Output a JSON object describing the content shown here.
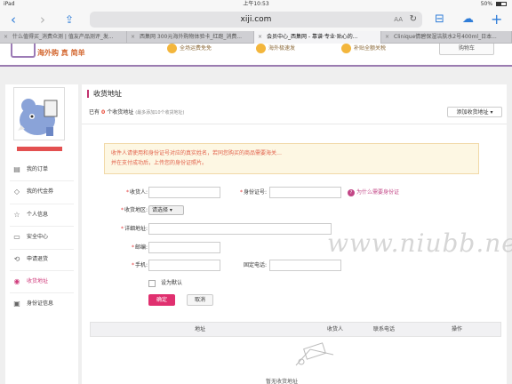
{
  "status_bar": {
    "device": "iPad",
    "time": "上午10:53",
    "battery": "50%"
  },
  "safari": {
    "url": "xiji.com",
    "font_btn": "AA",
    "back_icon": "chevron-left-icon",
    "forward_icon": "chevron-right-icon",
    "share_icon": "share-icon",
    "book_icon": "book-icon",
    "cloud_icon": "cloud-icon",
    "add_icon": "plus-icon"
  },
  "tabs": [
    {
      "label": "什么值得买_消费众测 | 值友产品测评_发..."
    },
    {
      "label": "西集网 300元海外购物体验卡_红跑_消费..."
    },
    {
      "label": "会员中心_西集网 - 靠谱·专业·贴心的..."
    },
    {
      "label": "Clinique倩碧保湿洁肤水2号400ml_日本..."
    }
  ],
  "site_header": {
    "slogan": "海外购 真 简单",
    "features": [
      "全场运费免免",
      "海外极速发",
      "补贴全额关税"
    ],
    "cart_label": "购物车"
  },
  "sidebar": {
    "items": [
      {
        "label": "我的订单",
        "icon": "document-icon"
      },
      {
        "label": "我的代金券",
        "icon": "tag-icon"
      },
      {
        "label": "个人信息",
        "icon": "star-icon"
      },
      {
        "label": "安全中心",
        "icon": "shield-icon"
      },
      {
        "label": "申请退货",
        "icon": "return-icon"
      },
      {
        "label": "收货地址",
        "icon": "location-pin-icon"
      },
      {
        "label": "身份证信息",
        "icon": "id-card-icon"
      }
    ]
  },
  "main": {
    "title": "收货地址",
    "count_prefix": "已有",
    "count": "0",
    "count_suffix": "个收货地址",
    "count_hint": "(最多添加10个收货地址)",
    "add_button": "添加收货地址 ▾",
    "notice_lines": [
      "收件人请使用和身份证号对应的真实姓名，若同您购买的商品需要海关…",
      "并在支付成功后，上传您的身份证照片。"
    ],
    "watermark": "www.niubb.net",
    "form": {
      "receiver_label": "收货人:",
      "idcard_label": "身份证号:",
      "idcard_help": "为什么需要身份证",
      "region_label": "收货地区:",
      "region_select": "请选择",
      "address_label": "详细地址:",
      "postcode_label": "邮编:",
      "phone_label": "手机:",
      "tel_label": "固定电话:",
      "default_label": "设为默认",
      "submit": "确定",
      "cancel": "取消"
    },
    "table_headers": [
      "地址",
      "收货人",
      "联系电话",
      "操作"
    ],
    "empty_text": "暂无收货地址"
  },
  "badge": {
    "icon": "值",
    "title": "什么值得买",
    "domain": "SMZDM"
  }
}
